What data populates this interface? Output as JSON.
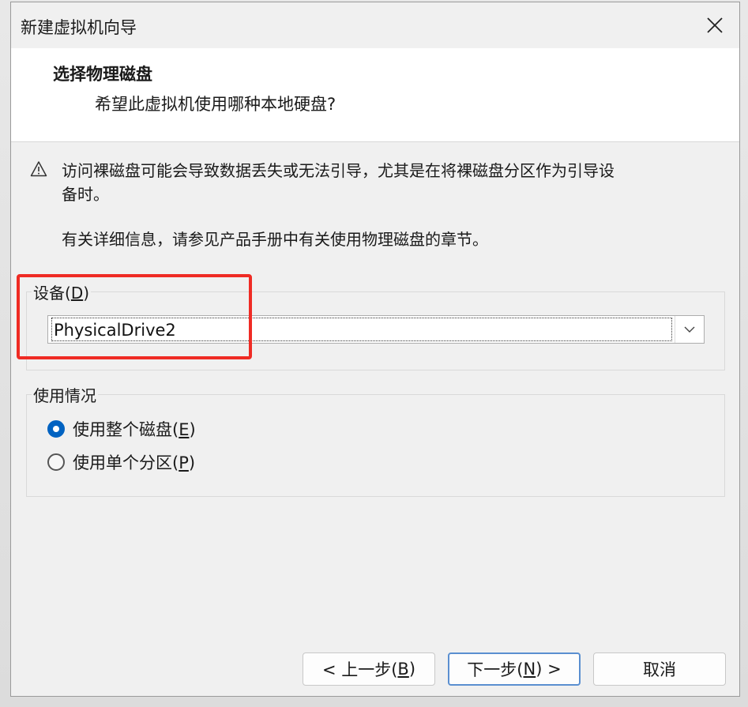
{
  "window": {
    "title": "新建虚拟机向导"
  },
  "header": {
    "title": "选择物理磁盘",
    "subtitle": "希望此虚拟机使用哪种本地硬盘?"
  },
  "warning": {
    "line1": "访问裸磁盘可能会导致数据丢失或无法引导，尤其是在将裸磁盘分区作为引导设",
    "line2": "备时。",
    "info": "有关详细信息，请参见产品手册中有关使用物理磁盘的章节。"
  },
  "device": {
    "label_prefix": "设备(",
    "label_mnemonic": "D",
    "label_suffix": ")",
    "selected": "PhysicalDrive2"
  },
  "usage": {
    "label": "使用情况",
    "options": [
      {
        "prefix": "使用整个磁盘(",
        "mnemonic": "E",
        "suffix": ")",
        "checked": true
      },
      {
        "prefix": "使用单个分区(",
        "mnemonic": "P",
        "suffix": ")",
        "checked": false
      }
    ]
  },
  "buttons": {
    "back_prefix": "< 上一步(",
    "back_mnemonic": "B",
    "back_suffix": ")",
    "next_prefix": "下一步(",
    "next_mnemonic": "N",
    "next_suffix": ") >",
    "cancel": "取消"
  },
  "colors": {
    "highlight": "#ef2b24",
    "radio_accent": "#0062c1"
  },
  "icons": {
    "close": "close-icon",
    "warning": "warning-triangle-icon",
    "dropdown": "chevron-down-icon"
  }
}
